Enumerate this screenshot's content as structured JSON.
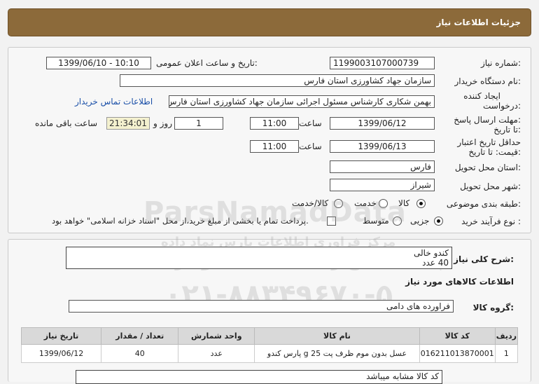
{
  "header": {
    "title": "جزئیات اطلاعات نیاز"
  },
  "form": {
    "need_number_label": "شماره نیاز:",
    "need_number": "1199003107000739",
    "announce_label": "تاریخ و ساعت اعلان عمومی:",
    "announce_value": "1399/06/10 - 10:10",
    "buyer_org_label": "نام دستگاه خریدار:",
    "buyer_org": "سازمان جهاد کشاورزی استان فارس",
    "creator_label_1": "ایجاد کننده",
    "creator_label_2": "درخواست:",
    "creator": "بهمن شکاری کارشناس مسئول اجرائی سازمان جهاد کشاورزی استان فارس",
    "contact_link": "اطلاعات تماس خریدار",
    "deadline_label_1": "مهلت ارسال پاسخ:",
    "deadline_label_2": "تا تاریخ:",
    "deadline_date": "1399/06/12",
    "time_label": "ساعت",
    "deadline_time": "11:00",
    "days_value": "1",
    "days_label": "روز و",
    "remaining_time": "21:34:01",
    "remaining_label": "ساعت باقی مانده",
    "validity_label_1": "حداقل تاریخ اعتبار",
    "validity_label_2": "قیمت: تا تاریخ:",
    "validity_date": "1399/06/13",
    "validity_time": "11:00",
    "province_label": "استان محل تحویل:",
    "province": "فارس",
    "city_label": "شهر محل تحویل:",
    "city": "شیراز",
    "category_label": "طبقه بندی موضوعی:",
    "category_options": [
      "کالا",
      "خدمت",
      "کالا/خدمت"
    ],
    "category_selected": "کالا",
    "process_label": "نوع فرآیند خرید :",
    "process_options": [
      "جزیی",
      "متوسط"
    ],
    "process_selected": "جزیی",
    "payment_note": "پرداخت تمام یا بخشی از مبلغ خرید،از محل \"اسناد خزانه اسلامی\" خواهد بود."
  },
  "details": {
    "summary_label": "شرح کلی نیاز:",
    "summary_lines": [
      "کندو خالی",
      "40 عدد"
    ],
    "goods_info_title": "اطلاعات کالاهای مورد نیاز",
    "goods_group_label": "گروه کالا:",
    "goods_group": "فراورده های دامی",
    "table_headers": [
      "ردیف",
      "کد کالا",
      "نام کالا",
      "واحد شمارش",
      "تعداد / مقدار",
      "تاریخ نیاز"
    ],
    "table_rows": [
      [
        "1",
        "016211013870001",
        "عسل بدون موم ظرف پت 25 g پارس کندو",
        "عدد",
        "40",
        "1399/06/12"
      ]
    ],
    "note": "کد کالا مشابه میباشد"
  },
  "watermark": {
    "brand": "ParsNamadData",
    "line1": "مرکز فراوری اطلاعات پارس نماد داده",
    "line2": "پایگاه اطلاع رسانی مناقصه و مزایده",
    "phone": "۰۲۱-۸۸۳۴۹۶۷۰-۵"
  }
}
